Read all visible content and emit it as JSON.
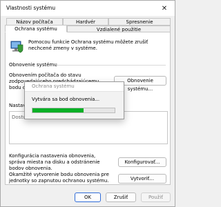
{
  "window": {
    "title": "Vlastnosti systému"
  },
  "tabs": {
    "row1": [
      "Názov počítača",
      "Hardvér",
      "Spresnenie"
    ],
    "row2": [
      "Ochrana systému",
      "Vzdialené použitie"
    ],
    "active": "Ochrana systému"
  },
  "intro_text": "Pomocou funkcie Ochrana systému môžete zrušiť nechcené zmeny v systéme.",
  "restore": {
    "group_title": "Obnovenie systému",
    "text": "Obnovením počítača do stavu zodpovedajúceho predchádzajúcemu bodu obnovenia",
    "button": "Obnovenie systému..."
  },
  "settings": {
    "group_title": "Nastavenia ochrany",
    "list_row_text": "Dostu",
    "configure_text": "Konfigurácia nastavenia obnovenia, správa miesta na disku a odstránenie bodov obnovenia.",
    "configure_button": "Konfigurovať...",
    "create_text": "Okamžité vytvorenie bodu obnovenia pre jednotky so zapnutou ochranou systému.",
    "create_button": "Vytvoriť..."
  },
  "progress_dialog": {
    "title": "Ochrana systému",
    "message": "Vytvára sa bod obnovenia...",
    "progress_fraction": 0.62,
    "color": "#06b025"
  },
  "footer": {
    "ok": "OK",
    "cancel": "Zrušiť",
    "apply": "Použiť"
  }
}
